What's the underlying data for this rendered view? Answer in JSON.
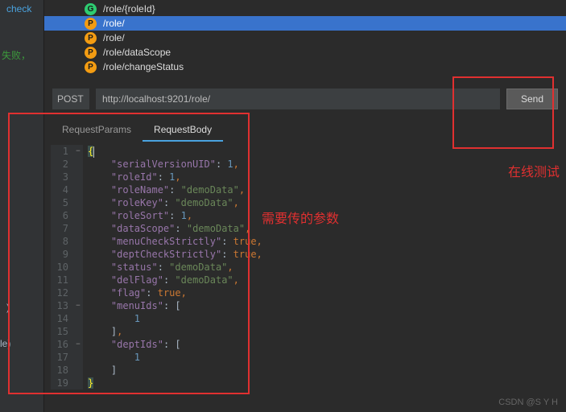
{
  "left": {
    "check": "check",
    "fail": "失败，\t",
    "paren": ")",
    "le_w": "le",
    "le_p": ")"
  },
  "endpoints": [
    {
      "badge": "G",
      "badgeClass": "g",
      "path": "/role/{roleId}",
      "selected": false
    },
    {
      "badge": "P",
      "badgeClass": "p",
      "path": "/role/",
      "selected": true
    },
    {
      "badge": "P",
      "badgeClass": "p",
      "path": "/role/",
      "selected": false
    },
    {
      "badge": "P",
      "badgeClass": "p",
      "path": "/role/dataScope",
      "selected": false
    },
    {
      "badge": "P",
      "badgeClass": "p",
      "path": "/role/changeStatus",
      "selected": false
    }
  ],
  "request": {
    "method": "POST",
    "url": "http://localhost:9201/role/",
    "send": "Send"
  },
  "tabs": {
    "params": "RequestParams",
    "body": "RequestBody"
  },
  "body_lines": [
    {
      "n": 1,
      "fold": "−",
      "html": "<span class='hl-brace'>{</span><span class='caret'></span>"
    },
    {
      "n": 2,
      "fold": "",
      "html": "    <span class='key'>\"serialVersionUID\"</span>: <span class='num'>1</span><span class='comma'>,</span>"
    },
    {
      "n": 3,
      "fold": "",
      "html": "    <span class='key'>\"roleId\"</span>: <span class='num'>1</span><span class='comma'>,</span>"
    },
    {
      "n": 4,
      "fold": "",
      "html": "    <span class='key'>\"roleName\"</span>: <span class='str'>\"demoData\"</span><span class='comma'>,</span>"
    },
    {
      "n": 5,
      "fold": "",
      "html": "    <span class='key'>\"roleKey\"</span>: <span class='str'>\"demoData\"</span><span class='comma'>,</span>"
    },
    {
      "n": 6,
      "fold": "",
      "html": "    <span class='key'>\"roleSort\"</span>: <span class='num'>1</span><span class='comma'>,</span>"
    },
    {
      "n": 7,
      "fold": "",
      "html": "    <span class='key'>\"dataScope\"</span>: <span class='str'>\"demoData\"</span><span class='comma'>,</span>"
    },
    {
      "n": 8,
      "fold": "",
      "html": "    <span class='key'>\"menuCheckStrictly\"</span>: <span class='kw'>true</span><span class='comma'>,</span>"
    },
    {
      "n": 9,
      "fold": "",
      "html": "    <span class='key'>\"deptCheckStrictly\"</span>: <span class='kw'>true</span><span class='comma'>,</span>"
    },
    {
      "n": 10,
      "fold": "",
      "html": "    <span class='key'>\"status\"</span>: <span class='str'>\"demoData\"</span><span class='comma'>,</span>"
    },
    {
      "n": 11,
      "fold": "",
      "html": "    <span class='key'>\"delFlag\"</span>: <span class='str'>\"demoData\"</span><span class='comma'>,</span>"
    },
    {
      "n": 12,
      "fold": "",
      "html": "    <span class='key'>\"flag\"</span>: <span class='kw'>true</span><span class='comma'>,</span>"
    },
    {
      "n": 13,
      "fold": "−",
      "html": "    <span class='key'>\"menuIds\"</span>: <span class='bracket'>[</span>"
    },
    {
      "n": 14,
      "fold": "",
      "html": "        <span class='num'>1</span>"
    },
    {
      "n": 15,
      "fold": "",
      "html": "    <span class='bracket'>]</span><span class='comma'>,</span>"
    },
    {
      "n": 16,
      "fold": "−",
      "html": "    <span class='key'>\"deptIds\"</span>: <span class='bracket'>[</span>"
    },
    {
      "n": 17,
      "fold": "",
      "html": "        <span class='num'>1</span>"
    },
    {
      "n": 18,
      "fold": "",
      "html": "    <span class='bracket'>]</span>"
    },
    {
      "n": 19,
      "fold": "",
      "html": "<span class='hl-brace'>}</span>"
    }
  ],
  "annotations": {
    "params_needed": "需要传的参数",
    "online_test": "在线测试"
  },
  "watermark": "CSDN @S Y H"
}
